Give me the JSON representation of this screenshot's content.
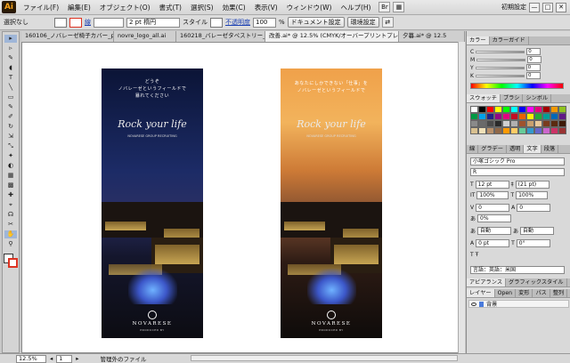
{
  "app": {
    "logo": "Ai"
  },
  "menubar": {
    "items": [
      "ファイル(F)",
      "編集(E)",
      "オブジェクト(O)",
      "書式(T)",
      "選択(S)",
      "効果(C)",
      "表示(V)",
      "ウィンドウ(W)",
      "ヘルプ(H)"
    ],
    "workspace": "初期設定",
    "window_buttons": [
      "—",
      "□",
      "✕"
    ]
  },
  "controlbar": {
    "selection_label": "選択なし",
    "stroke_label": "線",
    "stroke_weight": "2 pt 楕円",
    "style_label": "スタイル",
    "opacity_label": "不透明度",
    "opacity_value": "100",
    "opacity_unit": "%",
    "doc_setup_button": "ドキュメント設定",
    "prefs_button": "環境設定"
  },
  "tabs": [
    {
      "label": "160106_ノバレーゼ椅子カバー_p.ai*",
      "active": false
    },
    {
      "label": "novre_logo_all.ai",
      "active": false
    },
    {
      "label": "160218_バレーゼタペストリー_p.ai*",
      "active": false
    },
    {
      "label": "改善.ai* @ 12.5% (CMYK/オーバープリントプレビュー)",
      "active": true
    },
    {
      "label": "夕暮.ai* @ 12.5",
      "active": false
    }
  ],
  "artboards": [
    {
      "copy_lines": [
        "どうぞ",
        "ノバレーゼというフィールドで",
        "暴れてください"
      ],
      "script": "Rock your life",
      "tag": "NOVARESE GROUP RECRUITING",
      "brand": "NOVARESE",
      "brand_sub": "PRODUCED BY"
    },
    {
      "copy_lines": [
        "あなたにしかできない「仕事」を",
        "ノバレーゼというフィールドで"
      ],
      "script": "Rock your life",
      "tag": "NOVARESE GROUP RECRUITING",
      "brand": "NOVARESE",
      "brand_sub": "PRODUCED BY"
    }
  ],
  "statusbar": {
    "zoom": "12.5%",
    "page": "1",
    "info": "管理外のファイル"
  },
  "panels": {
    "color_tabs": [
      "カラー",
      "カラーガイド"
    ],
    "cmyk": [
      {
        "label": "C",
        "value": "0"
      },
      {
        "label": "M",
        "value": "0"
      },
      {
        "label": "Y",
        "value": "0"
      },
      {
        "label": "K",
        "value": "0"
      }
    ],
    "swatch_tabs": [
      "スウォッチ",
      "ブラシ",
      "シンボル"
    ],
    "swatch_colors": [
      "#ffffff",
      "#000000",
      "#ff0000",
      "#ffff00",
      "#00ff00",
      "#00ffff",
      "#0000ff",
      "#ff00ff",
      "#e6007e",
      "#a40000",
      "#f39800",
      "#8fc31f",
      "#009944",
      "#00a0e9",
      "#1d2088",
      "#920783",
      "#e4007f",
      "#c30d23",
      "#eb6100",
      "#fff100",
      "#22ac38",
      "#009e96",
      "#0068b7",
      "#601986",
      "#8a8a8a",
      "#6a6a6a",
      "#4a4a4a",
      "#2a2a2a",
      "#d0d0d0",
      "#b0b0b0",
      "#a0522d",
      "#c8a06e",
      "#e8c89a",
      "#7a3b1e",
      "#5b2a10",
      "#3c1a08",
      "#d8c090",
      "#f0e0b8",
      "#b8906a",
      "#906848",
      "#ff9900",
      "#ffcc66",
      "#66cc99",
      "#3399cc",
      "#6666cc",
      "#cc66cc",
      "#cc3366",
      "#993333"
    ],
    "char_tabs": [
      "線",
      "グラデー",
      "透明",
      "文字",
      "段落"
    ],
    "font": "小塚ゴシック Pro",
    "font_style": "R",
    "font_size": "12 pt",
    "leading": "(21 pt)",
    "h_scale": "100%",
    "v_scale": "100%",
    "tracking": "0",
    "kerning": "0",
    "tsume": "0%",
    "auto1": "自動",
    "auto2": "自動",
    "baseline": "0 pt",
    "rotation": "0°",
    "language_label": "言語：英語：米国",
    "appearance_tabs": [
      "アピアランス",
      "グラフィックスタイル"
    ],
    "layer_tabs": [
      "レイヤー",
      "Open",
      "変形",
      "パス",
      "整列"
    ],
    "layer_name": "背景"
  },
  "toolbar": {
    "tools": [
      "▸",
      "▹",
      "✎",
      "◖",
      "T",
      "╲",
      "▭",
      "✎",
      "✐",
      "↻",
      "⇲",
      "⤡",
      "✦",
      "◐",
      "▦",
      "▩",
      "✚",
      "⌖",
      "☊",
      "✂",
      "✋",
      "⚲"
    ]
  }
}
